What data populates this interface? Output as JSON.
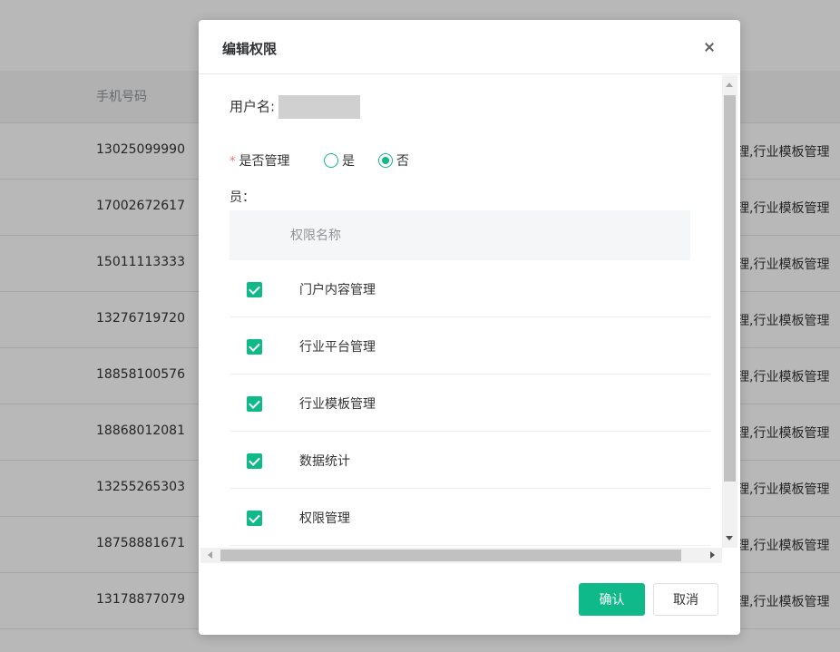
{
  "background": {
    "column_header": "手机号码",
    "rows": [
      {
        "phone": "13025099990",
        "perm": "理,行业模板管理"
      },
      {
        "phone": "17002672617",
        "perm": "理,行业模板管理"
      },
      {
        "phone": "15011113333",
        "perm": "理,行业模板管理"
      },
      {
        "phone": "13276719720",
        "perm": "理,行业模板管理"
      },
      {
        "phone": "18858100576",
        "perm": "理,行业模板管理"
      },
      {
        "phone": "18868012081",
        "perm": "理,行业模板管理"
      },
      {
        "phone": "13255265303",
        "perm": "理,行业模板管理"
      },
      {
        "phone": "18758881671",
        "perm": "理,行业模板管理"
      },
      {
        "phone": "13178877079",
        "perm": "理,行业模板管理"
      }
    ]
  },
  "dialog": {
    "title": "编辑权限",
    "username_label": "用户名:",
    "username_value": "",
    "admin_label": "是否管理",
    "admin_label_cont": "员：",
    "radio_yes": "是",
    "radio_no": "否",
    "selected": "否",
    "table_header": "权限名称",
    "permissions": [
      {
        "name": "门户内容管理",
        "checked": true
      },
      {
        "name": "行业平台管理",
        "checked": true
      },
      {
        "name": "行业模板管理",
        "checked": true
      },
      {
        "name": "数据统计",
        "checked": true
      },
      {
        "name": "权限管理",
        "checked": true
      }
    ],
    "confirm_label": "确认",
    "cancel_label": "取消"
  },
  "colors": {
    "accent": "#10b98a",
    "required": "#f56c6c"
  }
}
